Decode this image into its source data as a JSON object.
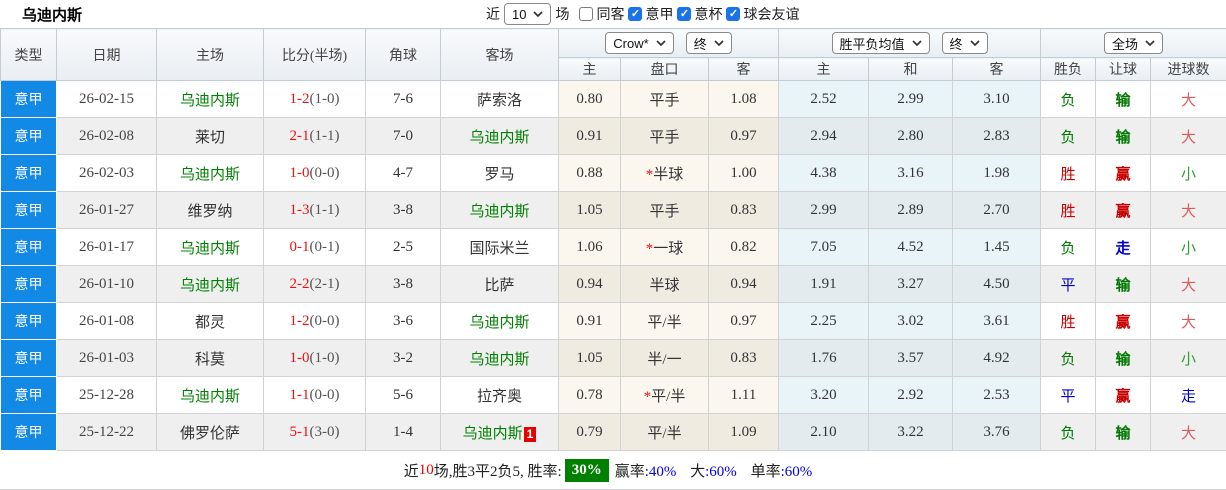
{
  "title": "乌迪内斯",
  "toolbar": {
    "recent_label": "近",
    "recent_count": "10",
    "matches_label": "场",
    "filters": [
      {
        "label": "同客",
        "checked": false
      },
      {
        "label": "意甲",
        "checked": true
      },
      {
        "label": "意杯",
        "checked": true
      },
      {
        "label": "球会友谊",
        "checked": true
      }
    ]
  },
  "header": {
    "type": "类型",
    "date": "日期",
    "home": "主场",
    "score": "比分(半场)",
    "corner": "角球",
    "away": "客场",
    "odds_source_select": "Crow*",
    "odds_stage_select": "终",
    "odds_home": "主",
    "odds_handicap": "盘口",
    "odds_away": "客",
    "avg_select": "胜平负均值",
    "avg_stage_select": "终",
    "avg_home": "主",
    "avg_draw": "和",
    "avg_away": "客",
    "scope_select": "全场",
    "result": "胜负",
    "letball": "让球",
    "goals": "进球数"
  },
  "rows": [
    {
      "league": "意甲",
      "date": "26-02-15",
      "home": "乌迪内斯",
      "score": "1-2",
      "half": "(1-0)",
      "corner": "7-6",
      "away": "萨索洛",
      "away_badge": "",
      "odds_home": "0.80",
      "handicap": "平手",
      "odds_away": "1.08",
      "avg_home": "2.52",
      "avg_draw": "2.99",
      "avg_away": "3.10",
      "result": "负",
      "letball": "输",
      "goals": "大"
    },
    {
      "league": "意甲",
      "date": "26-02-08",
      "home": "莱切",
      "score": "2-1",
      "half": "(1-1)",
      "corner": "7-0",
      "away": "乌迪内斯",
      "away_badge": "",
      "odds_home": "0.91",
      "handicap": "平手",
      "odds_away": "0.97",
      "avg_home": "2.94",
      "avg_draw": "2.80",
      "avg_away": "2.83",
      "result": "负",
      "letball": "输",
      "goals": "大"
    },
    {
      "league": "意甲",
      "date": "26-02-03",
      "home": "乌迪内斯",
      "score": "1-0",
      "half": "(0-0)",
      "corner": "4-7",
      "away": "罗马",
      "away_badge": "",
      "odds_home": "0.88",
      "handicap": "*半球",
      "odds_away": "1.00",
      "avg_home": "4.38",
      "avg_draw": "3.16",
      "avg_away": "1.98",
      "result": "胜",
      "letball": "赢",
      "goals": "小"
    },
    {
      "league": "意甲",
      "date": "26-01-27",
      "home": "维罗纳",
      "score": "1-3",
      "half": "(1-1)",
      "corner": "3-8",
      "away": "乌迪内斯",
      "away_badge": "",
      "odds_home": "1.05",
      "handicap": "平手",
      "odds_away": "0.83",
      "avg_home": "2.99",
      "avg_draw": "2.89",
      "avg_away": "2.70",
      "result": "胜",
      "letball": "赢",
      "goals": "大"
    },
    {
      "league": "意甲",
      "date": "26-01-17",
      "home": "乌迪内斯",
      "score": "0-1",
      "half": "(0-1)",
      "corner": "2-5",
      "away": "国际米兰",
      "away_badge": "",
      "odds_home": "1.06",
      "handicap": "*一球",
      "odds_away": "0.82",
      "avg_home": "7.05",
      "avg_draw": "4.52",
      "avg_away": "1.45",
      "result": "负",
      "letball": "走",
      "goals": "小"
    },
    {
      "league": "意甲",
      "date": "26-01-10",
      "home": "乌迪内斯",
      "score": "2-2",
      "half": "(2-1)",
      "corner": "3-8",
      "away": "比萨",
      "away_badge": "",
      "odds_home": "0.94",
      "handicap": "半球",
      "odds_away": "0.94",
      "avg_home": "1.91",
      "avg_draw": "3.27",
      "avg_away": "4.50",
      "result": "平",
      "letball": "输",
      "goals": "大"
    },
    {
      "league": "意甲",
      "date": "26-01-08",
      "home": "都灵",
      "score": "1-2",
      "half": "(0-0)",
      "corner": "3-6",
      "away": "乌迪内斯",
      "away_badge": "",
      "odds_home": "0.91",
      "handicap": "平/半",
      "odds_away": "0.97",
      "avg_home": "2.25",
      "avg_draw": "3.02",
      "avg_away": "3.61",
      "result": "胜",
      "letball": "赢",
      "goals": "大"
    },
    {
      "league": "意甲",
      "date": "26-01-03",
      "home": "科莫",
      "score": "1-0",
      "half": "(1-0)",
      "corner": "3-2",
      "away": "乌迪内斯",
      "away_badge": "",
      "odds_home": "1.05",
      "handicap": "半/一",
      "odds_away": "0.83",
      "avg_home": "1.76",
      "avg_draw": "3.57",
      "avg_away": "4.92",
      "result": "负",
      "letball": "输",
      "goals": "小"
    },
    {
      "league": "意甲",
      "date": "25-12-28",
      "home": "乌迪内斯",
      "score": "1-1",
      "half": "(0-0)",
      "corner": "5-6",
      "away": "拉齐奥",
      "away_badge": "",
      "odds_home": "0.78",
      "handicap": "*平/半",
      "odds_away": "1.11",
      "avg_home": "3.20",
      "avg_draw": "2.92",
      "avg_away": "2.53",
      "result": "平",
      "letball": "赢",
      "goals": "走"
    },
    {
      "league": "意甲",
      "date": "25-12-22",
      "home": "佛罗伦萨",
      "score": "5-1",
      "half": "(3-0)",
      "corner": "1-4",
      "away": "乌迪内斯",
      "away_badge": "1",
      "odds_home": "0.79",
      "handicap": "平/半",
      "odds_away": "1.09",
      "avg_home": "2.10",
      "avg_draw": "3.22",
      "avg_away": "3.76",
      "result": "负",
      "letball": "输",
      "goals": "大"
    }
  ],
  "footer": {
    "near_label": "近",
    "match_count": "10",
    "record_text": "场,胜3平2负5, 胜率:",
    "win_rate": "30%",
    "stats": [
      {
        "label": "赢率",
        "value": ":40%"
      },
      {
        "label": "大",
        "value": ":60%"
      },
      {
        "label": "单率",
        "value": ":60%"
      }
    ]
  },
  "colors": {
    "league_badge": "#1389e6",
    "team_highlight": "#008000",
    "score": "#ee1111",
    "win": "#c80000",
    "lose": "#007700",
    "draw": "#0000cc",
    "win_rate_badge_bg": "#008000"
  }
}
